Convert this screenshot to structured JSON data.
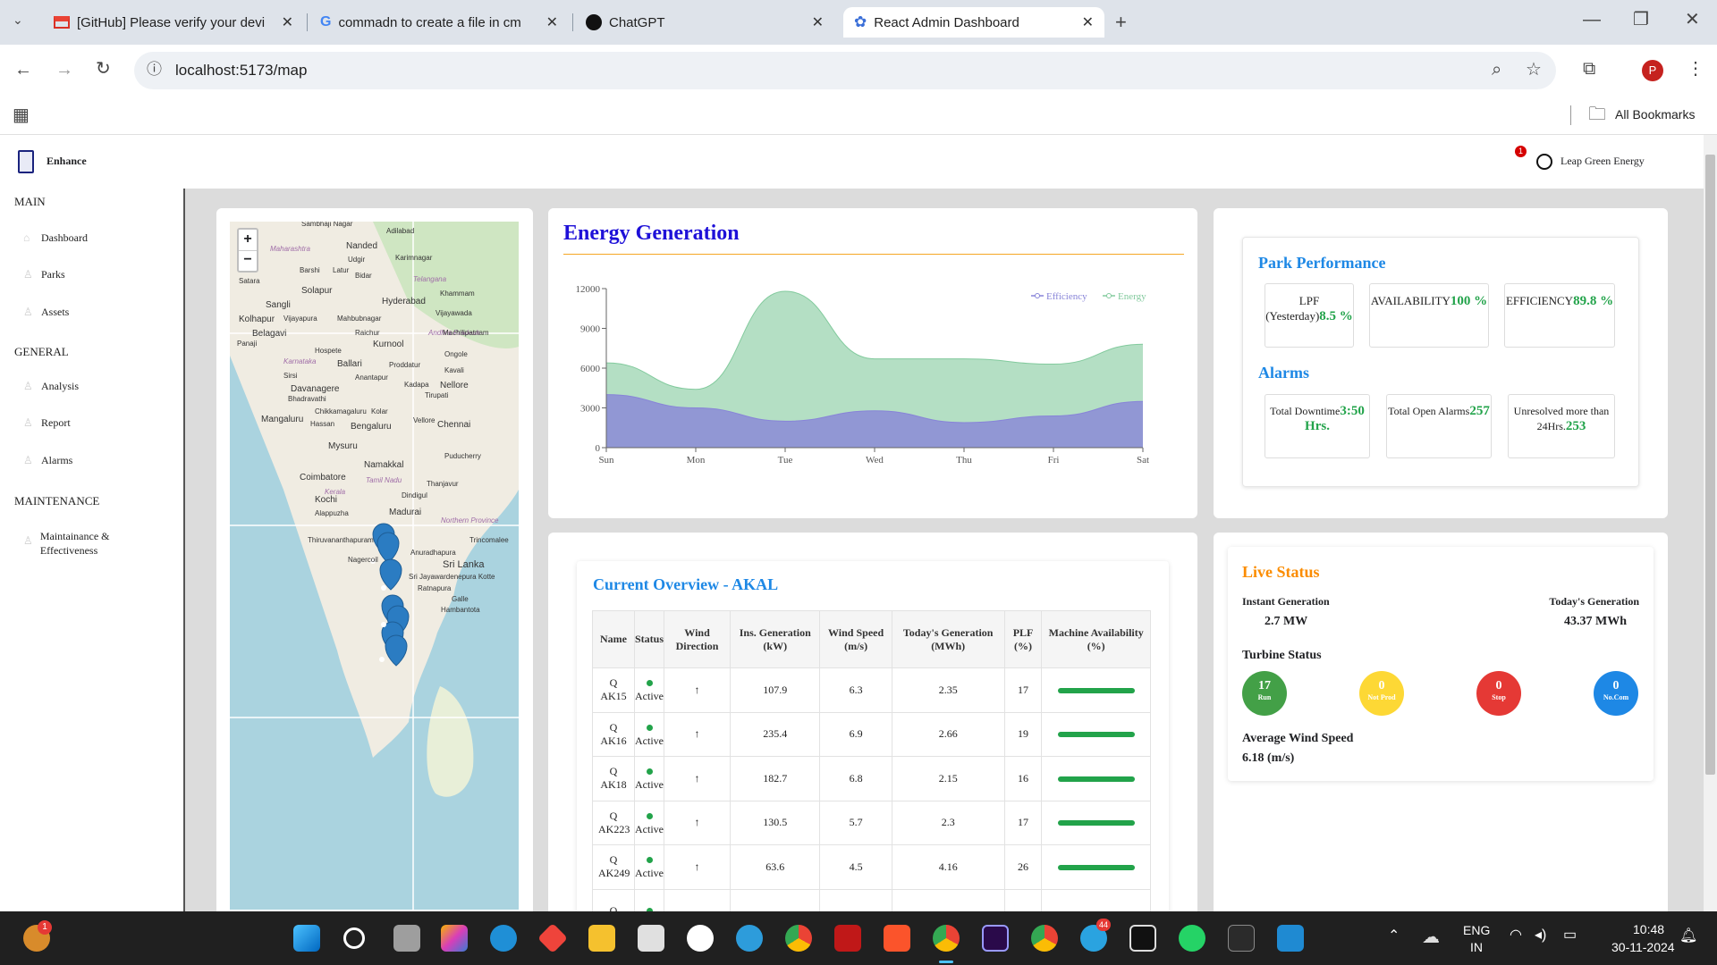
{
  "browser": {
    "tabs": [
      {
        "label": "[GitHub] Please verify your devi",
        "icon": "gmail-icon",
        "active": false
      },
      {
        "label": "commadn to create a file in cm",
        "icon": "google-icon",
        "active": false
      },
      {
        "label": "ChatGPT",
        "icon": "chatgpt-icon",
        "active": false
      },
      {
        "label": "React Admin Dashboard",
        "icon": "react-icon",
        "active": true
      }
    ],
    "url": "localhost:5173/map",
    "profile_initial": "P",
    "bookmarks_label": "All Bookmarks"
  },
  "app": {
    "brand": "Enhance",
    "notification_count": "1",
    "user": "Leap Green Energy"
  },
  "sidebar": {
    "sections": [
      {
        "title": "MAIN",
        "items": [
          "Dashboard",
          "Parks",
          "Assets"
        ]
      },
      {
        "title": "GENERAL",
        "items": [
          "Analysis",
          "Report",
          "Alarms"
        ]
      },
      {
        "title": "MAINTENANCE",
        "items": [
          "Maintainance & Effectiveness"
        ]
      }
    ]
  },
  "map": {
    "zoom_in": "+",
    "zoom_out": "−",
    "labels": [
      "Sambhaji Nagar",
      "Adilabad",
      "Nanded",
      "Maharashtra",
      "Udgir",
      "Karimnagar",
      "Barshi",
      "Latur",
      "Bidar",
      "Telangana",
      "Satara",
      "Solapur",
      "Khammam",
      "Sangli",
      "Hyderabad",
      "Kolhapur",
      "Vijayapura",
      "Mahbubnagar",
      "Vijayawada",
      "Belagavi",
      "Raichur",
      "Andhra Pradesh",
      "Machilipatnam",
      "Panaji",
      "Kurnool",
      "Hospete",
      "Ongole",
      "Karnataka",
      "Ballari",
      "Proddatur",
      "Kavali",
      "Sirsi",
      "Anantapur",
      "Davanagere",
      "Kadapa",
      "Nellore",
      "Bhadravathi",
      "Tirupati",
      "Chikkamagaluru",
      "Kolar",
      "Mangaluru",
      "Hassan",
      "Vellore",
      "Bengaluru",
      "Chennai",
      "Mysuru",
      "Puducherry",
      "Namakkal",
      "Coimbatore",
      "Tamil Nadu",
      "Thanjavur",
      "Kerala",
      "Kochi",
      "Dindigul",
      "Alappuzha",
      "Madurai",
      "Northern Province",
      "Thiruvananthapuram",
      "Trincomalee",
      "Nagercoil",
      "Anuradhapura",
      "Sri Lanka",
      "Sri Jayawardenepura Kotte",
      "Ratnapura",
      "Galle",
      "Hambantota"
    ]
  },
  "energy": {
    "title": "Energy Generation"
  },
  "chart_data": {
    "type": "area",
    "title": "Energy Generation",
    "categories": [
      "Sun",
      "Mon",
      "Tue",
      "Wed",
      "Thu",
      "Fri",
      "Sat"
    ],
    "ylim": [
      0,
      12000
    ],
    "yticks": [
      "0",
      "3000",
      "6000",
      "9000",
      "12000"
    ],
    "series": [
      {
        "name": "Efficiency",
        "color": "#8884d8",
        "values": [
          4000,
          3000,
          2000,
          2780,
          1890,
          2390,
          3490
        ]
      },
      {
        "name": "Energy",
        "color": "#82ca9d",
        "values": [
          6400,
          4400,
          11800,
          6700,
          6700,
          6300,
          7800
        ]
      }
    ],
    "legend": "top-right"
  },
  "park": {
    "title": "Park Performance",
    "kpis": [
      {
        "label": "LPF (Yesterday)",
        "value": "8.5 %"
      },
      {
        "label": "AVAILABILITY",
        "value": "100 %"
      },
      {
        "label": "EFFICIENCY",
        "value": "89.8 %"
      }
    ],
    "alarms_title": "Alarms",
    "alarms": [
      {
        "label": "Total Downtime",
        "value": "3:50 Hrs."
      },
      {
        "label": "Total Open Alarms",
        "value": "257"
      },
      {
        "label": "Unresolved more than 24Hrs.",
        "value": "253"
      }
    ]
  },
  "overview": {
    "title": "Current Overview - AKAL",
    "columns": [
      "Name",
      "Status",
      "Wind Direction",
      "Ins. Generation (kW)",
      "Wind Speed (m/s)",
      "Today's Generation (MWh)",
      "PLF (%)",
      "Machine Availability (%)"
    ],
    "rows": [
      {
        "name": "Q AK15",
        "status": "Active",
        "dir": "↑",
        "ins": "107.9",
        "ws": "6.3",
        "today": "2.35",
        "plf": "17",
        "avail": 1
      },
      {
        "name": "Q AK16",
        "status": "Active",
        "dir": "↑",
        "ins": "235.4",
        "ws": "6.9",
        "today": "2.66",
        "plf": "19",
        "avail": 1
      },
      {
        "name": "Q AK18",
        "status": "Active",
        "dir": "↑",
        "ins": "182.7",
        "ws": "6.8",
        "today": "2.15",
        "plf": "16",
        "avail": 1
      },
      {
        "name": "Q AK223",
        "status": "Active",
        "dir": "↑",
        "ins": "130.5",
        "ws": "5.7",
        "today": "2.3",
        "plf": "17",
        "avail": 1
      },
      {
        "name": "Q AK249",
        "status": "Active",
        "dir": "↑",
        "ins": "63.6",
        "ws": "4.5",
        "today": "4.16",
        "plf": "26",
        "avail": 1
      },
      {
        "name": "Q",
        "status": "",
        "dir": "",
        "ins": "",
        "ws": "",
        "today": "",
        "plf": "",
        "avail": null
      }
    ]
  },
  "live": {
    "title": "Live Status",
    "instant_label": "Instant Generation",
    "instant_value": "2.7 MW",
    "today_label": "Today's Generation",
    "today_value": "43.37 MWh",
    "turbine_label": "Turbine Status",
    "turbines": [
      {
        "count": "17",
        "label": "Run",
        "color": "#43a047"
      },
      {
        "count": "0",
        "label": "Not Prod",
        "color": "#fdd835"
      },
      {
        "count": "0",
        "label": "Stop",
        "color": "#e53935"
      },
      {
        "count": "0",
        "label": "No.Com",
        "color": "#1e88e5"
      }
    ],
    "avg_wind_label": "Average Wind Speed",
    "avg_wind_value": "6.18 (m/s)"
  },
  "taskbar": {
    "lang": "ENG",
    "region": "IN",
    "time": "10:48",
    "date": "30-11-2024",
    "badge_left": "1",
    "badge_telegram": "44"
  }
}
